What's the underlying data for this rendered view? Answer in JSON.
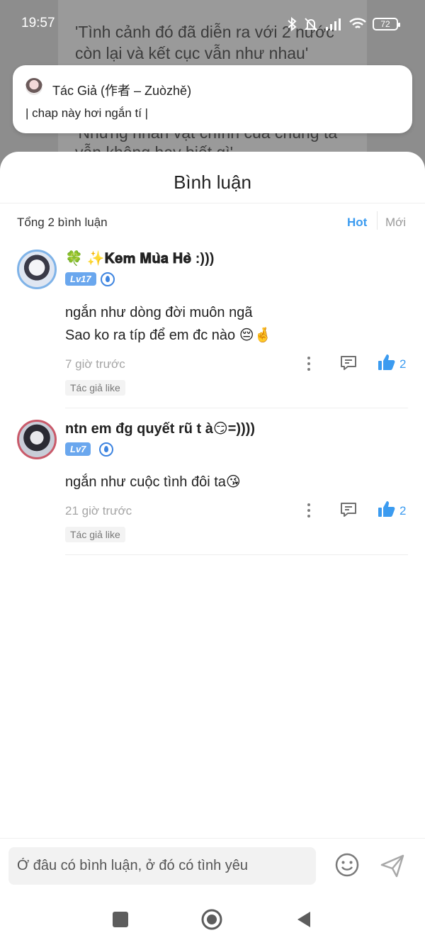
{
  "status_bar": {
    "time": "19:57",
    "battery": "72"
  },
  "background_text": {
    "line1": "'Tình cảnh đó đã diễn ra với 2 nước",
    "line2": "còn lại và kết cục vẫn như nhau'",
    "line3": "'Những nhân vật chính của chúng ta",
    "line4": "vẫn không hay biết gì'"
  },
  "author_note": {
    "name": "Tác Giả (作者 – Zuòzhě)",
    "message": "| chap này hơi ngắn tí |"
  },
  "sheet": {
    "title": "Bình luận",
    "total": "Tổng 2 bình luận",
    "sort_hot": "Hot",
    "sort_new": "Mới"
  },
  "comments": [
    {
      "username": "🍀 ✨𝐊𝐞𝐦 𝐌𝐮̀𝐚 𝐇𝐞̀ :)))",
      "level": "Lv17",
      "lines": [
        "ngắn như dòng đời muôn ngã",
        "Sao ko ra típ để em đc nào 😔🤞"
      ],
      "time": "7 giờ trước",
      "likes": "2",
      "author_like": "Tác giả like"
    },
    {
      "username": "ntn em đg quyết rũ t à😏=))))",
      "level": "Lv7",
      "lines": [
        "ngắn như cuộc tình đôi ta😘"
      ],
      "time": "21 giờ trước",
      "likes": "2",
      "author_like": "Tác giả like"
    }
  ],
  "input": {
    "placeholder": "Ở đâu có bình luận, ở đó có tình yêu"
  },
  "colors": {
    "accent": "#3b9bf0",
    "level_badge": "#6aa7ee"
  },
  "icons": [
    "more-vertical-icon",
    "reply-icon",
    "thumbs-up-icon",
    "emoji-icon",
    "send-icon",
    "recents-icon",
    "home-icon",
    "back-icon"
  ]
}
